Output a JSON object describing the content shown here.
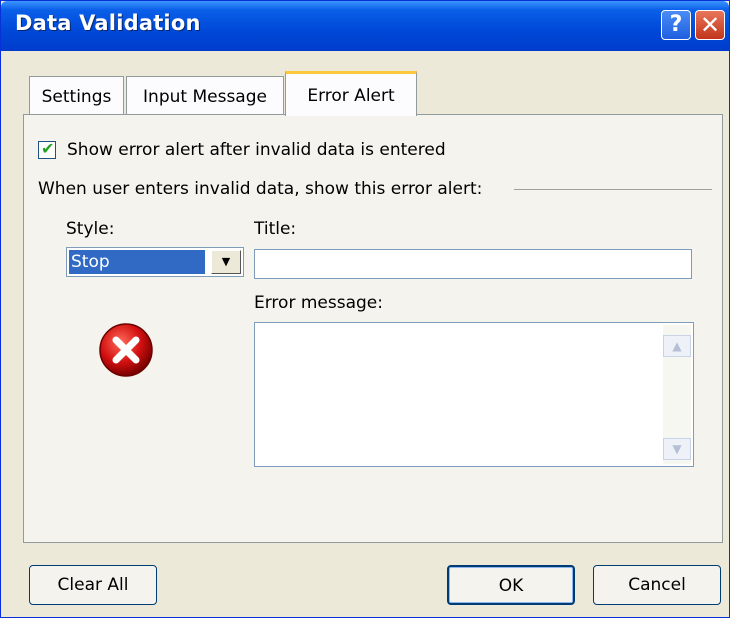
{
  "window": {
    "title": "Data Validation"
  },
  "tabs": [
    {
      "label": "Settings"
    },
    {
      "label": "Input Message"
    },
    {
      "label": "Error Alert"
    }
  ],
  "error_alert": {
    "checkbox_label": "Show error alert after invalid data is entered",
    "checkbox_checked": true,
    "group_label": "When user enters invalid data, show this error alert:",
    "style_label": "Style:",
    "style_value": "Stop",
    "title_label": "Title:",
    "title_value": "",
    "message_label": "Error message:",
    "message_value": "",
    "icon": "error-stop-icon"
  },
  "buttons": {
    "clear_all": "Clear All",
    "ok": "OK",
    "cancel": "Cancel"
  },
  "colors": {
    "titlebar": "#0048d8",
    "selection": "#316ac5",
    "dialog_bg": "#ece9d8"
  }
}
